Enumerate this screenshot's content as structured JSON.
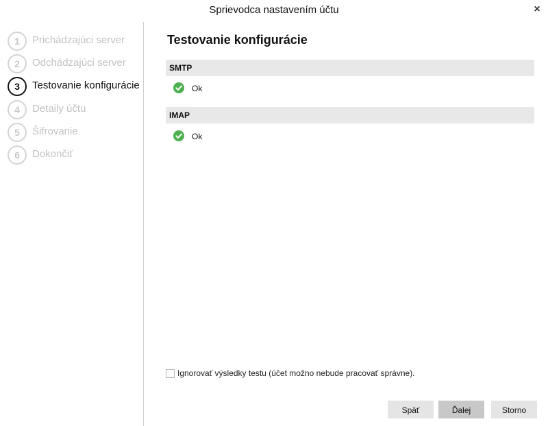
{
  "window": {
    "title": "Sprievodca nastavením účtu",
    "close_icon": "×"
  },
  "sidebar": {
    "steps": [
      {
        "number": "1",
        "label": "Prichádzajúci server",
        "state": "inactive"
      },
      {
        "number": "2",
        "label": "Odchádzajúci server",
        "state": "inactive"
      },
      {
        "number": "3",
        "label": "Testovanie konfigurácie",
        "state": "active"
      },
      {
        "number": "4",
        "label": "Detaily účtu",
        "state": "inactive"
      },
      {
        "number": "5",
        "label": "Šifrovanie",
        "state": "inactive"
      },
      {
        "number": "6",
        "label": "Dokončiť",
        "state": "inactive"
      }
    ]
  },
  "main": {
    "heading": "Testovanie konfigurácie",
    "sections": [
      {
        "header": "SMTP",
        "status": "Ok",
        "status_icon": "check-circle-icon",
        "status_color": "#4caf50"
      },
      {
        "header": "IMAP",
        "status": "Ok",
        "status_icon": "check-circle-icon",
        "status_color": "#4caf50"
      }
    ],
    "ignore_checkbox": {
      "label": "Ignorovať výsledky testu (účet možno nebude pracovať správne).",
      "checked": false
    }
  },
  "buttons": {
    "back": "Späť",
    "next": "Ďalej",
    "cancel": "Storno"
  }
}
